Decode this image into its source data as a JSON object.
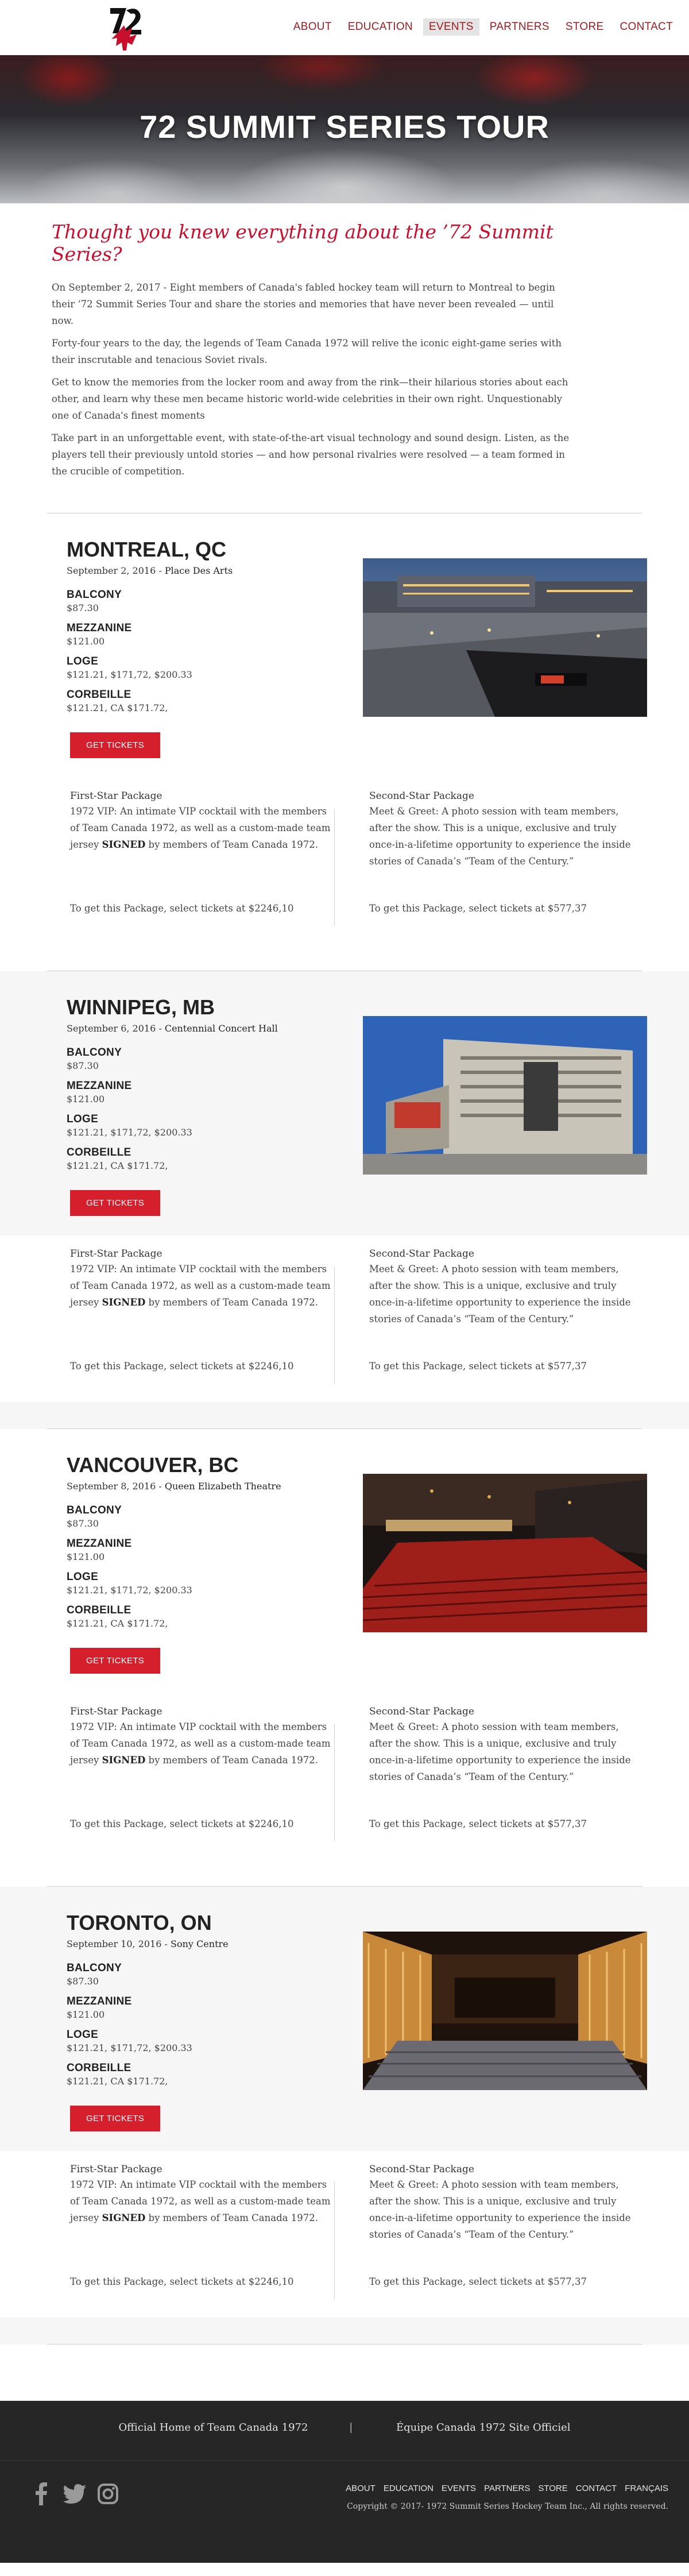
{
  "header": {
    "logo_text": "72",
    "nav": [
      "ABOUT",
      "EDUCATION",
      "EVENTS",
      "PARTNERS",
      "STORE",
      "CONTACT"
    ],
    "active_nav": "EVENTS"
  },
  "hero": {
    "title": "72 SUMMIT SERIES TOUR"
  },
  "intro": {
    "heading": "Thought you knew everything about the ’72 Summit Series?",
    "paragraphs": [
      "On September 2, 2017 - Eight members of Canada's fabled hockey team will return to Montreal to begin their ‘72 Summit Series Tour and share the stories and memories that have never been revealed — until now.",
      "Forty-four years to the day, the legends of Team Canada 1972 will relive the iconic eight-game series with their inscrutable and tenacious Soviet rivals.",
      "Get to know the memories from the locker room and away from the rink—their hilarious stories about each other, and learn why these men became historic world-wide celebrities in their own right. Unquestionably one of Canada's finest moments",
      "Take part in an unforgettable event, with state-of-the-art visual technology and sound design. Listen, as the players tell their previously untold stories — and how personal rivalries were resolved — a team formed in the crucible of competition."
    ]
  },
  "venues": [
    {
      "city": "MONTREAL, QC",
      "date": "September 2, 2016 -",
      "hall": "Place Des Arts",
      "tiers": [
        {
          "name": "BALCONY",
          "price": "$87.30"
        },
        {
          "name": "MEZZANINE",
          "price": "$121.00"
        },
        {
          "name": "LOGE",
          "price": "$121.21, $171,72, $200.33"
        },
        {
          "name": "CORBEILLE",
          "price": "$121.21, CA $171.72,"
        }
      ],
      "button": "GET TICKETS",
      "photo": "plaza"
    },
    {
      "city": "WINNIPEG, MB",
      "date": "September 6, 2016 -",
      "hall": "Centennial Concert Hall",
      "tiers": [
        {
          "name": "BALCONY",
          "price": "$87.30"
        },
        {
          "name": "MEZZANINE",
          "price": "$121.00"
        },
        {
          "name": "LOGE",
          "price": "$121.21, $171,72, $200.33"
        },
        {
          "name": "CORBEILLE",
          "price": "$121.21, CA $171.72,"
        }
      ],
      "button": "GET TICKETS",
      "photo": "building"
    },
    {
      "city": "VANCOUVER, BC",
      "date": "September 8, 2016 -",
      "hall": "Queen Elizabeth Theatre",
      "tiers": [
        {
          "name": "BALCONY",
          "price": "$87.30"
        },
        {
          "name": "MEZZANINE",
          "price": "$121.00"
        },
        {
          "name": "LOGE",
          "price": "$121.21, $171,72, $200.33"
        },
        {
          "name": "CORBEILLE",
          "price": "$121.21, CA $171.72,"
        }
      ],
      "button": "GET TICKETS",
      "photo": "theatre-red"
    },
    {
      "city": "TORONTO, ON",
      "date": "September 10, 2016 -",
      "hall": "Sony Centre",
      "tiers": [
        {
          "name": "BALCONY",
          "price": "$87.30"
        },
        {
          "name": "MEZZANINE",
          "price": "$121.00"
        },
        {
          "name": "LOGE",
          "price": "$121.21, $171,72, $200.33"
        },
        {
          "name": "CORBEILLE",
          "price": "$121.21, CA $171.72,"
        }
      ],
      "button": "GET TICKETS",
      "photo": "theatre-gold"
    }
  ],
  "packages": {
    "first": {
      "title": "First-Star Package",
      "desc_before": "1972 VIP: An intimate VIP cocktail with the members of Team Canada 1972, as well as a custom-made team jersey ",
      "desc_strong": "SIGNED",
      "desc_after": " by members of Team Canada 1972.",
      "note": "To get this Package, select tickets at $2246,10"
    },
    "second": {
      "title": "Second-Star Package",
      "desc": "Meet & Greet: A photo session with team members, after the show. This is a unique, exclusive and truly once-in-a-lifetime opportunity to experience the inside stories of Canada’s “Team of the Century.”",
      "note": "To get this Package, select tickets at $577,37"
    }
  },
  "footer": {
    "link_left": "Official Home of Team Canada 1972",
    "separator": "|",
    "link_right": "Équipe Canada 1972 Site Officiel",
    "nav": [
      "ABOUT",
      "EDUCATION",
      "EVENTS",
      "PARTNERS",
      "STORE",
      "CONTACT",
      "FRANÇAIS"
    ],
    "copyright": "Copyright © 2017- 1972 Summit Series Hockey Team Inc., All rights reserved.",
    "social_icons": [
      "facebook-icon",
      "twitter-icon",
      "instagram-icon"
    ]
  },
  "colors": {
    "brand_red": "#d61f2c",
    "heading_red": "#c8102e",
    "nav_red": "#9b1b1f",
    "footer_bg": "#262626"
  }
}
